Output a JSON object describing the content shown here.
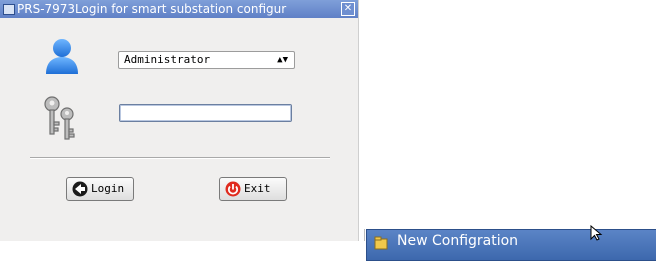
{
  "window": {
    "title": "PRS-7973Login for smart substation configur",
    "close_glyph": "✕"
  },
  "login": {
    "user_select_value": "Administrator",
    "select_arrows": "▲▼",
    "password_value": "",
    "login_label": "Login",
    "exit_label": "Exit"
  },
  "menu": {
    "new_config_label": "New Configration"
  },
  "colors": {
    "titlebar": "#6f8fd0",
    "menu_highlight": "#4a74b8",
    "exit_icon": "#e02b1f"
  },
  "icons": [
    "window-app-icon",
    "close-icon",
    "user-icon",
    "keys-icon",
    "login-arrow-icon",
    "power-icon",
    "new-config-icon",
    "mouse-cursor-icon"
  ]
}
